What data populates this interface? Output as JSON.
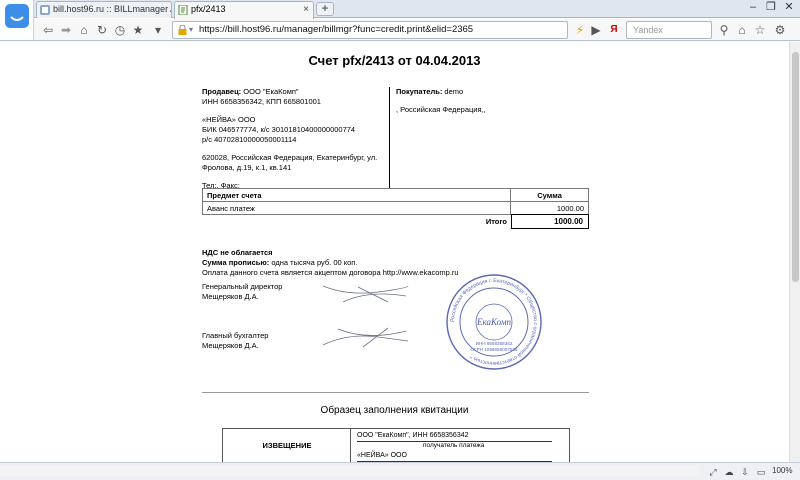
{
  "browser": {
    "tabs": [
      {
        "label": "bill.host96.ru :: BILLmanager Adva...",
        "active": false
      },
      {
        "label": "pfx/2413",
        "active": true
      }
    ],
    "new_tab_symbol": "+",
    "url": "https://bill.host96.ru/manager/billmgr?func=credit.print&elid=2365",
    "search_placeholder": "Yandex",
    "zoom": "100%"
  },
  "invoice": {
    "title": "Счет pfx/2413 от 04.04.2013",
    "seller": {
      "label": "Продавец:",
      "name": "ООО \"ЕкаКомп\"",
      "inn_kpp": "ИНН 6658356342, КПП 665801001",
      "bank": "«НЕЙВА» ООО",
      "bik": "БИК 046577774, к/с 30101810400000000774",
      "account": "р/с 40702810000050001114",
      "address1": "620028, Российская Федерация, Екатеринбург, ул.",
      "address2": "Фролова, д.19, к.1, кв.141",
      "phone": "Тел:, Факс:"
    },
    "buyer": {
      "label": "Покупатель:",
      "name": "demo",
      "address": ", Российская Федерация,,"
    },
    "table": {
      "col_item": "Предмет счета",
      "col_sum": "Сумма",
      "rows": [
        {
          "item": "Аванс платеж",
          "sum": "1000.00"
        }
      ],
      "total_label": "Итого",
      "total_value": "1000.00"
    },
    "vat": "НДС не облагается",
    "amount_words_label": "Сумма прописью:",
    "amount_words": "одна тысяча руб. 00 коп.",
    "offer": "Оплата данного счета является акцептом договора http://www.ekacomp.ru",
    "director_title": "Генеральный директор",
    "director_name": "Мещеряков Д.А.",
    "accountant_title": "Главный бухгалтер",
    "accountant_name": "Мещеряков Д.А.",
    "stamp": {
      "center": "ЕкаКомп",
      "ring_text": "Российская Федерация г. Екатеринбург * Общество с ограниченной ответственностью *",
      "inn": "ИНН 6658356342",
      "ogrn": "ОГРН 1096658007536"
    }
  },
  "receipt": {
    "section_title": "Образец заполнения квитанции",
    "notice": "ИЗВЕЩЕНИЕ",
    "payee": "ООО \"ЕкаКомп\", ИНН 6658356342",
    "payee_caption": "получатель платежа",
    "bank": "«НЕЙВА» ООО"
  }
}
